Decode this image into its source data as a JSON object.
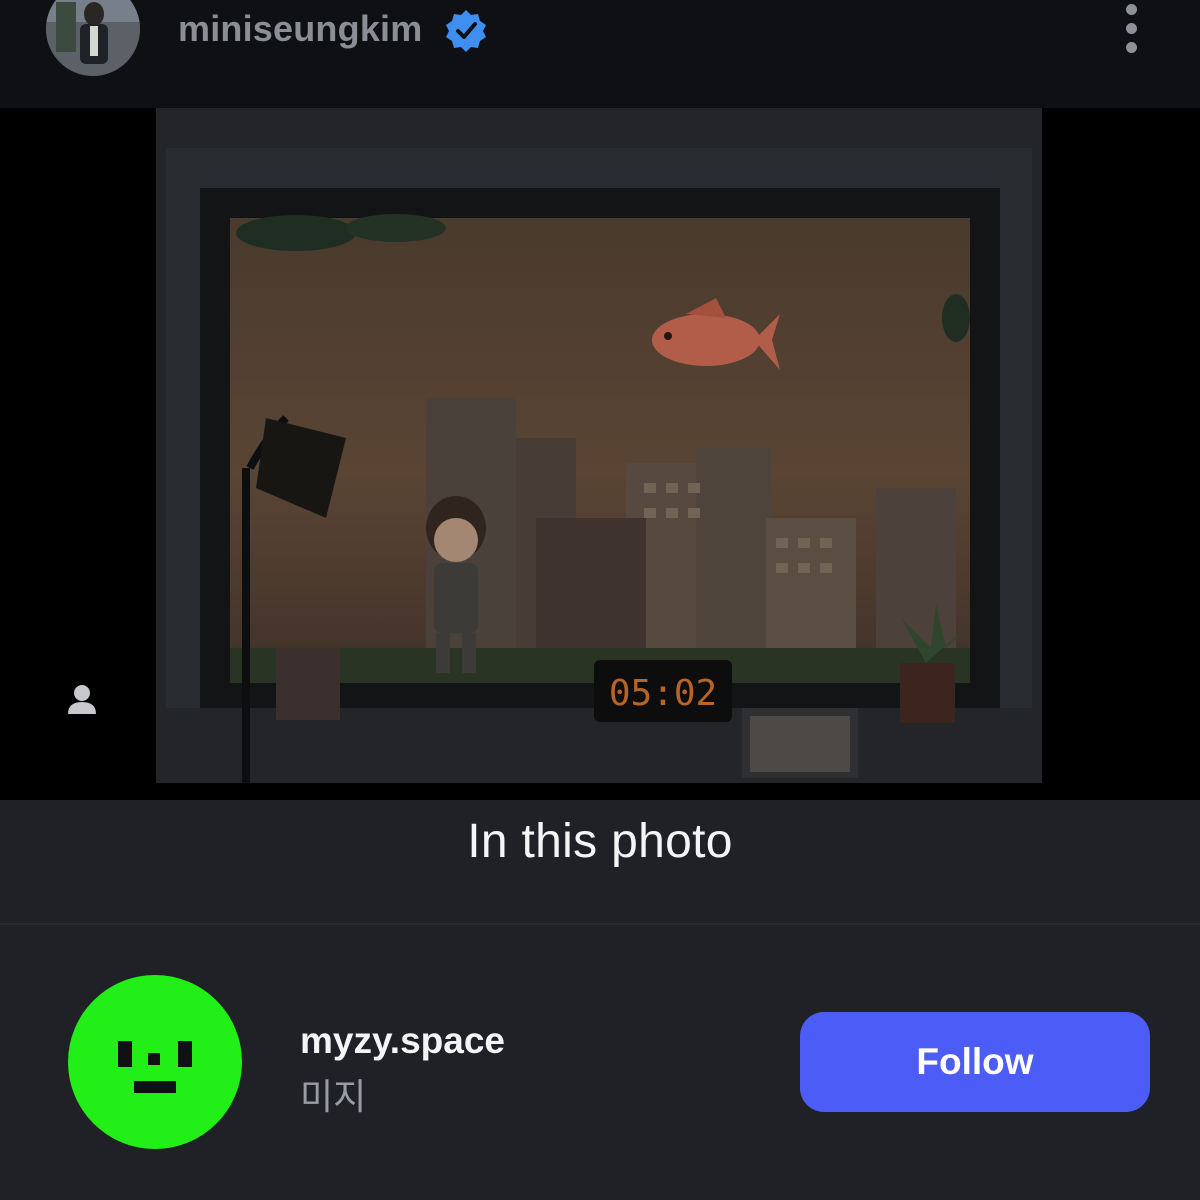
{
  "header": {
    "username": "miniseungkim",
    "verified_icon": "verified-badge-icon",
    "more_icon": "more-options-icon"
  },
  "photo": {
    "clock_display": "05:02",
    "tag_icon": "person-tag-icon"
  },
  "sheet": {
    "title": "In this photo",
    "tagged_users": [
      {
        "handle": "myzy.space",
        "name": "미지",
        "follow_label": "Follow"
      }
    ]
  },
  "colors": {
    "follow_button": "#4b5cf7",
    "avatar_green": "#22ee18",
    "sheet_background": "#1f2126",
    "verified_blue": "#3f8ff1"
  }
}
